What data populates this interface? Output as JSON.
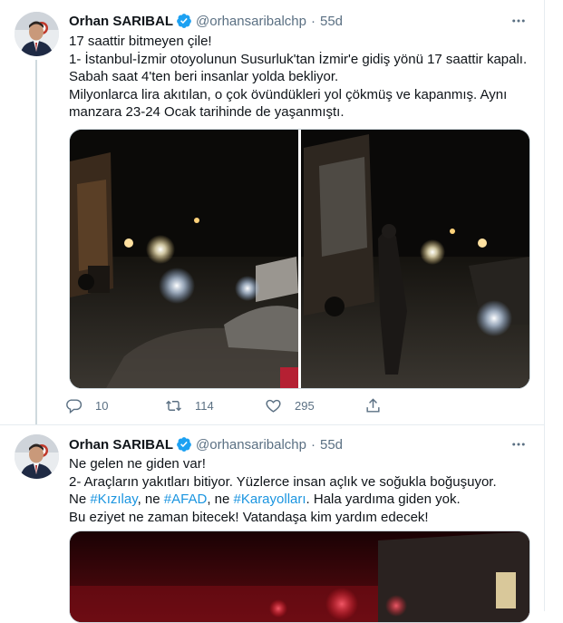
{
  "tweets": [
    {
      "author": {
        "name": "Orhan SARIBAL",
        "handle": "@orhansaribalchp"
      },
      "separator": "·",
      "time": "55d",
      "lines": [
        "17 saattir bitmeyen çile!",
        "1- İstanbul-İzmir otoyolunun Susurluk'tan İzmir'e gidiş yönü 17 saattir kapalı.",
        "Sabah saat 4'ten beri insanlar yolda bekliyor.",
        "Milyonlarca lira akıtılan, o çok övündükleri yol çökmüş ve kapanmış. Aynı",
        "manzara 23-24 Ocak tarihinde de yaşanmıştı."
      ],
      "stats": {
        "replies": "10",
        "retweets": "114",
        "likes": "295"
      }
    },
    {
      "author": {
        "name": "Orhan SARIBAL",
        "handle": "@orhansaribalchp"
      },
      "separator": "·",
      "time": "55d",
      "lines": [
        "Ne gelen ne giden var!",
        "2- Araçların yakıtları bitiyor. Yüzlerce insan açlık ve soğukla boğuşuyor."
      ],
      "line3": {
        "t1": "Ne ",
        "h1": "#Kızılay",
        "t2": ", ne ",
        "h2": "#AFAD",
        "t3": ", ne ",
        "h3": "#Karayolları",
        "t4": ". Hala yardıma giden yok."
      },
      "line4": "Bu eziyet ne zaman bitecek! Vatandaşa kim yardım edecek!"
    }
  ],
  "colors": {
    "link": "#1b95e0",
    "secondary": "#5b7083",
    "verified": "#1da1f2",
    "divider": "#e6ecf0"
  },
  "icons": [
    "verified-badge-icon",
    "more-icon",
    "reply-icon",
    "retweet-icon",
    "like-icon",
    "share-icon"
  ]
}
